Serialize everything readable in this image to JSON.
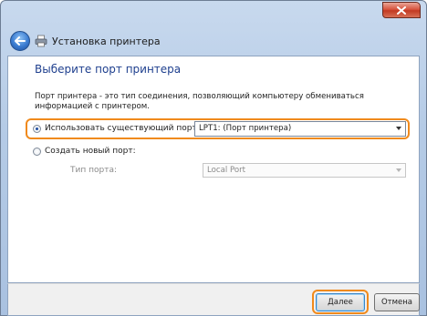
{
  "window": {
    "title": "Установка принтера",
    "icons": {
      "back": "back-arrow-icon",
      "printer": "printer-icon",
      "close": "close-icon"
    }
  },
  "main": {
    "heading": "Выберите порт принтера",
    "description": "Порт принтера - это тип соединения, позволяющий компьютеру обмениваться информацией с принтером.",
    "use_existing": {
      "label": "Использовать существующий порт:",
      "selected_value": "LPT1: (Порт принтера)",
      "checked": true
    },
    "create_new": {
      "label": "Создать новый порт:",
      "checked": false,
      "type_label": "Тип порта:",
      "type_value": "Local Port"
    }
  },
  "footer": {
    "next_label": "Далее",
    "cancel_label": "Отмена"
  },
  "colors": {
    "highlight": "#f08a1c",
    "heading": "#1e3f8e",
    "close_button": "#c23a22"
  }
}
